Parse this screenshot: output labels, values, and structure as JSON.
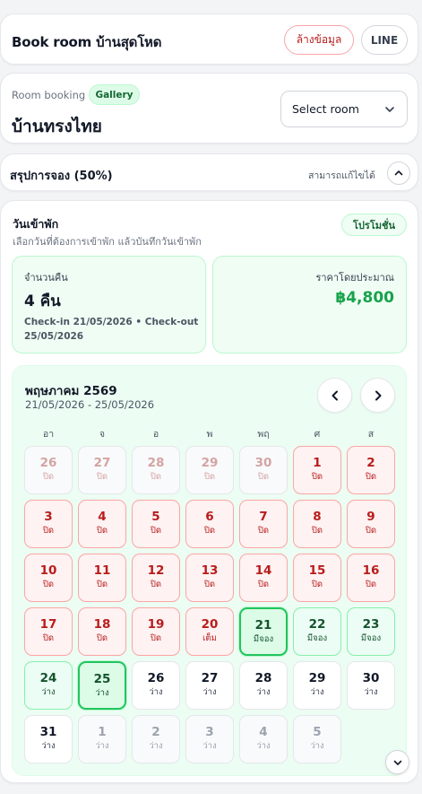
{
  "header": {
    "title": "Book room บ้านสุดโหด",
    "clear_label": "ล้างข้อมูล",
    "line_label": "LINE"
  },
  "room": {
    "subtitle": "Room booking",
    "gallery_label": "Gallery",
    "name": "บ้านทรงไทย",
    "select_value": "Select room"
  },
  "summary": {
    "label": "สรุปการจอง (50%)",
    "editable_note": "สามารถแก้ไขได้"
  },
  "dates": {
    "heading": "วันเข้าพัก",
    "instruction": "เลือกวันที่ต้องการเข้าพัก แล้วบันทึกวันเข้าพัก",
    "promo_label": "โปรโมชั่น",
    "nights_label": "จำนวนคืน",
    "nights_value": "4 คืน",
    "dates_detail": "Check-in 21/05/2026 • Check-out 25/05/2026",
    "price_label": "ราคาโดยประมาณ",
    "price_value": "฿4,800"
  },
  "calendar": {
    "month": "พฤษภาคม 2569",
    "range": "21/05/2026 - 25/05/2026",
    "weekdays": [
      "อา",
      "จ",
      "อ",
      "พ",
      "พฤ",
      "ศ",
      "ส"
    ],
    "days": [
      {
        "n": "26",
        "s": "ปิด",
        "state": "past"
      },
      {
        "n": "27",
        "s": "ปิด",
        "state": "past"
      },
      {
        "n": "28",
        "s": "ปิด",
        "state": "past"
      },
      {
        "n": "29",
        "s": "ปิด",
        "state": "past"
      },
      {
        "n": "30",
        "s": "ปิด",
        "state": "past"
      },
      {
        "n": "1",
        "s": "ปิด",
        "state": "closed"
      },
      {
        "n": "2",
        "s": "ปิด",
        "state": "closed"
      },
      {
        "n": "3",
        "s": "ปิด",
        "state": "closed"
      },
      {
        "n": "4",
        "s": "ปิด",
        "state": "closed"
      },
      {
        "n": "5",
        "s": "ปิด",
        "state": "closed"
      },
      {
        "n": "6",
        "s": "ปิด",
        "state": "closed"
      },
      {
        "n": "7",
        "s": "ปิด",
        "state": "closed"
      },
      {
        "n": "8",
        "s": "ปิด",
        "state": "closed"
      },
      {
        "n": "9",
        "s": "ปิด",
        "state": "closed"
      },
      {
        "n": "10",
        "s": "ปิด",
        "state": "closed"
      },
      {
        "n": "11",
        "s": "ปิด",
        "state": "closed"
      },
      {
        "n": "12",
        "s": "ปิด",
        "state": "closed"
      },
      {
        "n": "13",
        "s": "ปิด",
        "state": "closed"
      },
      {
        "n": "14",
        "s": "ปิด",
        "state": "closed"
      },
      {
        "n": "15",
        "s": "ปิด",
        "state": "closed"
      },
      {
        "n": "16",
        "s": "ปิด",
        "state": "closed"
      },
      {
        "n": "17",
        "s": "ปิด",
        "state": "closed"
      },
      {
        "n": "18",
        "s": "ปิด",
        "state": "closed"
      },
      {
        "n": "19",
        "s": "ปิด",
        "state": "closed"
      },
      {
        "n": "20",
        "s": "เต็ม",
        "state": "closed"
      },
      {
        "n": "21",
        "s": "มีจอง",
        "state": "sel"
      },
      {
        "n": "22",
        "s": "มีจอง",
        "state": "booked"
      },
      {
        "n": "23",
        "s": "มีจอง",
        "state": "booked"
      },
      {
        "n": "24",
        "s": "ว่าง",
        "state": "booked"
      },
      {
        "n": "25",
        "s": "ว่าง",
        "state": "sel"
      },
      {
        "n": "26",
        "s": "ว่าง",
        "state": "free"
      },
      {
        "n": "27",
        "s": "ว่าง",
        "state": "free"
      },
      {
        "n": "28",
        "s": "ว่าง",
        "state": "free"
      },
      {
        "n": "29",
        "s": "ว่าง",
        "state": "free"
      },
      {
        "n": "30",
        "s": "ว่าง",
        "state": "free"
      },
      {
        "n": "31",
        "s": "ว่าง",
        "state": "free"
      },
      {
        "n": "1",
        "s": "ว่าง",
        "state": "next"
      },
      {
        "n": "2",
        "s": "ว่าง",
        "state": "next"
      },
      {
        "n": "3",
        "s": "ว่าง",
        "state": "next"
      },
      {
        "n": "4",
        "s": "ว่าง",
        "state": "next"
      },
      {
        "n": "5",
        "s": "ว่าง",
        "state": "next"
      }
    ]
  },
  "colors": {
    "accent_green": "#16a34a",
    "closed_red": "#b91c1c",
    "panel_green": "#ecfdf3"
  },
  "icons": {
    "select": "chevron-down-icon",
    "collapse": "chevron-up-icon",
    "prev": "chevron-left-icon",
    "next": "chevron-right-icon",
    "scroll": "chevron-down-icon"
  }
}
